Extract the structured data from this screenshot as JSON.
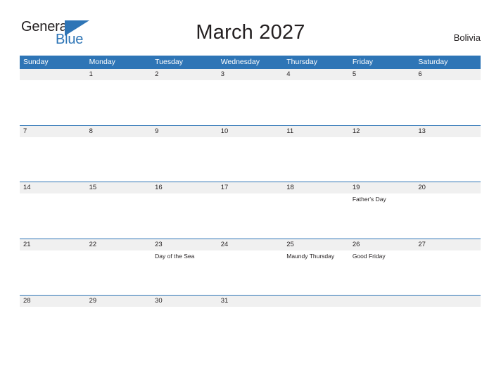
{
  "header": {
    "logo": {
      "word_one": "General",
      "word_two": "Blue",
      "triangle_icon": "blue-triangle-icon",
      "colors": {
        "word_one": "#231f20",
        "word_two": "#2e75b6",
        "triangle": "#2e75b6"
      }
    },
    "title": "March 2027",
    "locale": "Bolivia"
  },
  "colors": {
    "header_blue": "#2e75b6",
    "row_divider_blue": "#2e75b6",
    "day_band_gray": "#f0f0f0",
    "text": "#231f20",
    "page_background": "#ffffff"
  },
  "calendar": {
    "weekdays": [
      "Sunday",
      "Monday",
      "Tuesday",
      "Wednesday",
      "Thursday",
      "Friday",
      "Saturday"
    ],
    "weeks": [
      [
        {
          "day": "",
          "event": ""
        },
        {
          "day": "1",
          "event": ""
        },
        {
          "day": "2",
          "event": ""
        },
        {
          "day": "3",
          "event": ""
        },
        {
          "day": "4",
          "event": ""
        },
        {
          "day": "5",
          "event": ""
        },
        {
          "day": "6",
          "event": ""
        }
      ],
      [
        {
          "day": "7",
          "event": ""
        },
        {
          "day": "8",
          "event": ""
        },
        {
          "day": "9",
          "event": ""
        },
        {
          "day": "10",
          "event": ""
        },
        {
          "day": "11",
          "event": ""
        },
        {
          "day": "12",
          "event": ""
        },
        {
          "day": "13",
          "event": ""
        }
      ],
      [
        {
          "day": "14",
          "event": ""
        },
        {
          "day": "15",
          "event": ""
        },
        {
          "day": "16",
          "event": ""
        },
        {
          "day": "17",
          "event": ""
        },
        {
          "day": "18",
          "event": ""
        },
        {
          "day": "19",
          "event": "Father's Day"
        },
        {
          "day": "20",
          "event": ""
        }
      ],
      [
        {
          "day": "21",
          "event": ""
        },
        {
          "day": "22",
          "event": ""
        },
        {
          "day": "23",
          "event": "Day of the Sea"
        },
        {
          "day": "24",
          "event": ""
        },
        {
          "day": "25",
          "event": "Maundy Thursday"
        },
        {
          "day": "26",
          "event": "Good Friday"
        },
        {
          "day": "27",
          "event": ""
        }
      ],
      [
        {
          "day": "28",
          "event": ""
        },
        {
          "day": "29",
          "event": ""
        },
        {
          "day": "30",
          "event": ""
        },
        {
          "day": "31",
          "event": ""
        },
        {
          "day": "",
          "event": ""
        },
        {
          "day": "",
          "event": ""
        },
        {
          "day": "",
          "event": ""
        }
      ]
    ]
  }
}
